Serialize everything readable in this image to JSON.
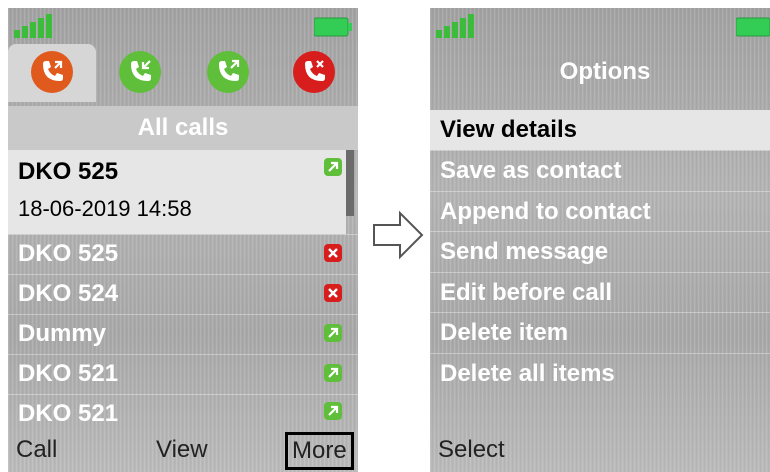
{
  "left_screen": {
    "tabs": [
      {
        "name": "all-calls-tab",
        "icon": "phone-transfer-icon",
        "color": "#e05a1e",
        "active": true
      },
      {
        "name": "received-calls-tab",
        "icon": "phone-incoming-icon",
        "color": "#5fbf3a",
        "active": false
      },
      {
        "name": "dialed-calls-tab",
        "icon": "phone-outgoing-icon",
        "color": "#5fbf3a",
        "active": false
      },
      {
        "name": "missed-calls-tab",
        "icon": "phone-missed-icon",
        "color": "#d81d1d",
        "active": false
      }
    ],
    "title": "All calls",
    "selected_call": {
      "name": "DKO 525",
      "datetime": "18-06-2019 14:58",
      "status_icon": "outgoing-call-icon"
    },
    "calls": [
      {
        "name": "DKO 525",
        "status_icon": "missed-call-icon"
      },
      {
        "name": "DKO 524",
        "status_icon": "missed-call-icon"
      },
      {
        "name": "Dummy",
        "status_icon": "outgoing-call-icon"
      },
      {
        "name": "DKO 521",
        "status_icon": "outgoing-call-icon"
      },
      {
        "name": "DKO 521",
        "status_icon": "outgoing-call-icon"
      }
    ],
    "softkeys": {
      "left": "Call",
      "middle": "View",
      "right": "More"
    }
  },
  "right_screen": {
    "title": "Options",
    "options": [
      {
        "label": "View details",
        "selected": true
      },
      {
        "label": "Save as contact",
        "selected": false
      },
      {
        "label": "Append to contact",
        "selected": false
      },
      {
        "label": "Send message",
        "selected": false
      },
      {
        "label": "Edit before call",
        "selected": false
      },
      {
        "label": "Delete item",
        "selected": false
      },
      {
        "label": "Delete all items",
        "selected": false
      }
    ],
    "softkeys": {
      "left": "Select"
    }
  },
  "colors": {
    "signal": "#3bbd3b",
    "battery": "#33cc55",
    "outgoing": "#5fbf3a",
    "missed": "#d81d1d"
  }
}
